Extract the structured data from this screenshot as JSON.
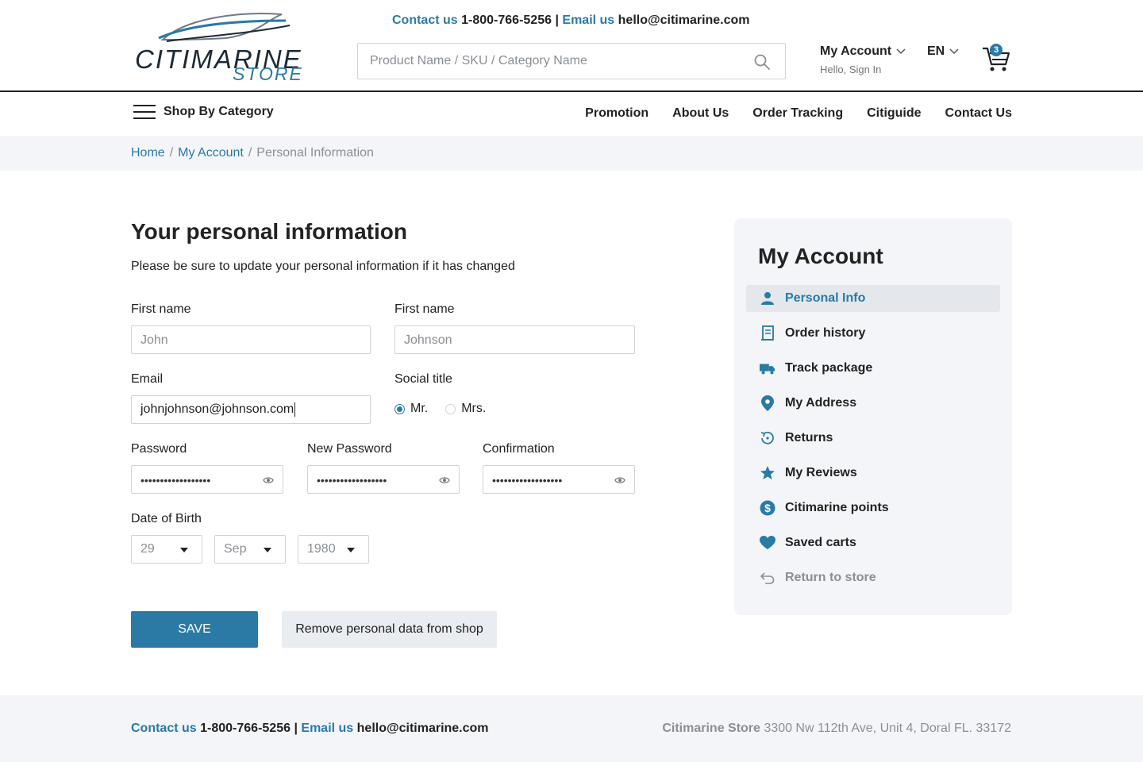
{
  "header": {
    "logo_main": "CITIMARINE",
    "logo_sub": "STORE",
    "contact": {
      "contact_label": "Contact us",
      "phone": "1-800-766-5256",
      "divider": "|",
      "email_label": "Email us",
      "email": "hello@citimarine.com"
    },
    "search": {
      "placeholder": "Product Name / SKU / Category Name",
      "value": ""
    },
    "account": {
      "title": "My Account",
      "subtitle": "Hello, Sign In"
    },
    "language": "EN",
    "cart_count": "3"
  },
  "nav": {
    "shop_by_category": "Shop By Category",
    "links": [
      "Promotion",
      "About Us",
      "Order Tracking",
      "Citiguide",
      "Contact Us"
    ]
  },
  "breadcrumb": {
    "items": [
      "Home",
      "My Account",
      "Personal Information"
    ],
    "separator": "/"
  },
  "form": {
    "title": "Your personal information",
    "description": "Please be sure to update your personal information if it has changed",
    "first_name": {
      "label": "First name",
      "placeholder": "John"
    },
    "last_name": {
      "label": "First name",
      "placeholder": "Johnson"
    },
    "email": {
      "label": "Email",
      "value": "johnjohnson@johnson.com"
    },
    "social_title": {
      "label": "Social title",
      "options": [
        "Mr.",
        "Mrs."
      ],
      "selected": "Mr."
    },
    "password": {
      "label": "Password",
      "value": "••••••••••••••••••"
    },
    "new_password": {
      "label": "New Password",
      "value": "••••••••••••••••••"
    },
    "confirmation": {
      "label": "Confirmation",
      "value": "••••••••••••••••••"
    },
    "dob": {
      "label": "Date of Birth",
      "day": "29",
      "month": "Sep",
      "year": "1980"
    },
    "save_label": "SAVE",
    "remove_label": "Remove personal data from shop"
  },
  "sidebar": {
    "title": "My Account",
    "items": [
      {
        "label": "Personal Info",
        "icon": "person-icon",
        "active": true
      },
      {
        "label": "Order history",
        "icon": "receipt-icon"
      },
      {
        "label": "Track package",
        "icon": "truck-icon"
      },
      {
        "label": "My Address",
        "icon": "location-pin-icon"
      },
      {
        "label": "Returns",
        "icon": "return-icon"
      },
      {
        "label": "My Reviews",
        "icon": "star-icon"
      },
      {
        "label": "Citimarine points",
        "icon": "dollar-icon"
      },
      {
        "label": "Saved carts",
        "icon": "heart-icon"
      },
      {
        "label": "Return to store",
        "icon": "back-arrow-icon",
        "muted": true
      }
    ]
  },
  "footer": {
    "contact_label": "Contact us",
    "phone": "1-800-766-5256",
    "divider": "|",
    "email_label": "Email us",
    "email": "hello@citimarine.com",
    "store_name": "Citimarine Store",
    "address": "3300 Nw 112th Ave, Unit 4, Doral FL. 33172"
  },
  "colors": {
    "accent": "#2a7aa5",
    "text": "#222222",
    "muted": "#8a8f95",
    "panel": "#f3f5f8"
  }
}
